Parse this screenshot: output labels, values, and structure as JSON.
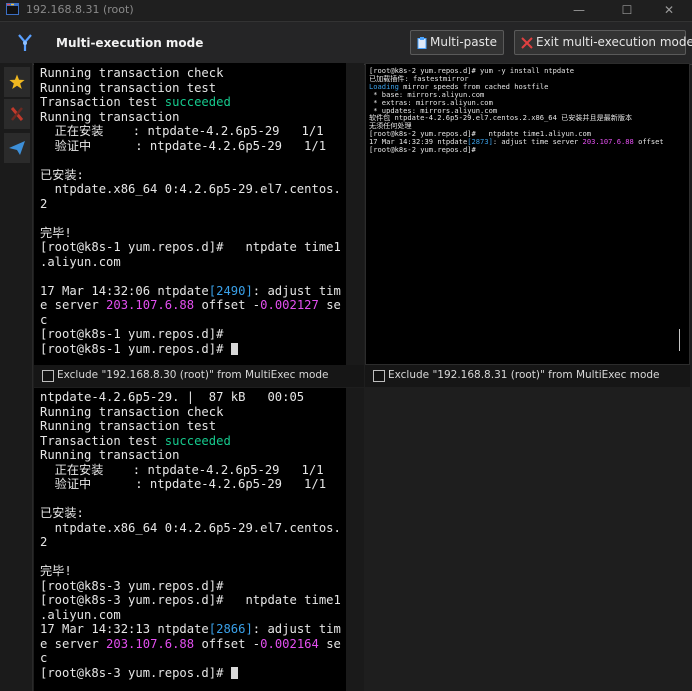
{
  "window": {
    "title": "192.168.8.31 (root)",
    "minimize_glyph": "—",
    "maximize_glyph": "☐",
    "close_glyph": "✕"
  },
  "toolbar": {
    "mode_title": "Multi-execution mode",
    "multipaste_label": "Multi-paste",
    "exit_label": "Exit multi-execution mode",
    "colors": {
      "exit_icon": "#e04040",
      "paste_icon": "#4aa3ff",
      "logo": "#5aa0ff"
    }
  },
  "sidebar": {
    "icons": [
      "star-icon",
      "tools-icon",
      "send-icon"
    ]
  },
  "panes": {
    "p1": {
      "lines": [
        "Running transaction check",
        "Running transaction test",
        "Transaction test succeeded",
        "Running transaction",
        "  正在安装    : ntpdate-4.2.6p5-29   1/1",
        "  验证中      : ntpdate-4.2.6p5-29   1/1",
        "",
        "已安装:",
        "  ntpdate.x86_64 0:4.2.6p5-29.el7.centos.",
        "2",
        "",
        "完毕!",
        "[root@k8s-1 yum.repos.d]#   ntpdate time1",
        ".aliyun.com",
        "",
        "17 Mar 14:32:06 ntpdate[2490]: adjust tim",
        "e server 203.107.6.88 offset -0.002127 se",
        "c",
        "[root@k8s-1 yum.repos.d]#",
        "[root@k8s-1 yum.repos.d]# "
      ],
      "exclude_label": "Exclude \"192.168.8.30 (root)\" from MultiExec mode"
    },
    "p2": {
      "lines": [
        "[root@k8s-2 yum.repos.d]# yum -y install ntpdate",
        "已加载插件: fastestmirror",
        "Loading mirror speeds from cached hostfile",
        " * base: mirrors.aliyun.com",
        " * extras: mirrors.aliyun.com",
        " * updates: mirrors.aliyun.com",
        "软件包 ntpdate-4.2.6p5-29.el7.centos.2.x86_64 已安装并且是最新版本",
        "无须任何处理",
        "[root@k8s-2 yum.repos.d]#   ntpdate time1.aliyun.com",
        "17 Mar 14:32:39 ntpdate[2873]: adjust time server 203.107.6.88 offset",
        "[root@k8s-2 yum.repos.d]# "
      ],
      "exclude_label": "Exclude \"192.168.8.31 (root)\" from MultiExec mode"
    },
    "p3": {
      "lines": [
        "ntpdate-4.2.6p5-29. |  87 kB   00:05",
        "Running transaction check",
        "Running transaction test",
        "Transaction test succeeded",
        "Running transaction",
        "  正在安装    : ntpdate-4.2.6p5-29   1/1",
        "  验证中      : ntpdate-4.2.6p5-29   1/1",
        "",
        "已安装:",
        "  ntpdate.x86_64 0:4.2.6p5-29.el7.centos.",
        "2",
        "",
        "完毕!",
        "[root@k8s-3 yum.repos.d]#",
        "[root@k8s-3 yum.repos.d]#   ntpdate time1",
        ".aliyun.com",
        "17 Mar 14:32:13 ntpdate[2866]: adjust tim",
        "e server 203.107.6.88 offset -0.002164 se",
        "c",
        "[root@k8s-3 yum.repos.d]# "
      ]
    }
  },
  "highlight_colors": {
    "success": "#16c98d",
    "ip": "#e34ff0",
    "pid": "#3aa0e8"
  }
}
